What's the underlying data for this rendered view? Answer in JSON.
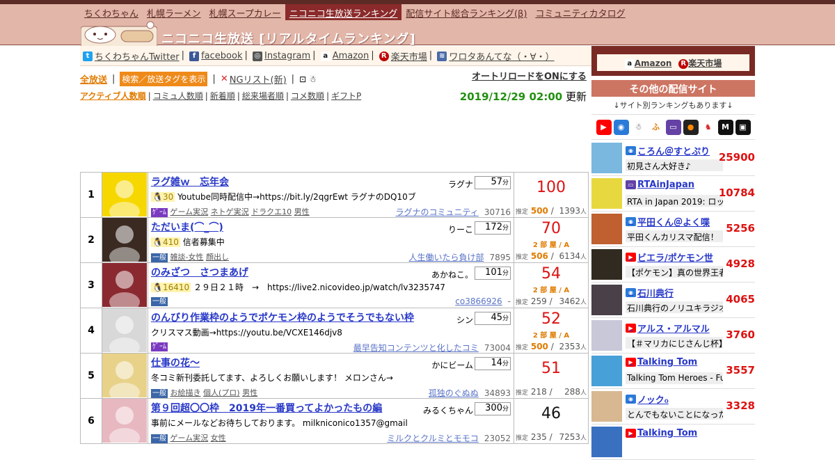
{
  "nav": {
    "items": [
      "ちくわちゃん",
      "札幌ラーメン",
      "札幌スープカレー",
      "ニコニコ生放送ランキング",
      "配信サイト総合ランキング(β)",
      "コミュニティカタログ"
    ],
    "selected_index": 3
  },
  "site_title": "ニコニコ生放送 [リアルタイムランキング]",
  "sublinks": {
    "twitter": "ちくわちゃんTwitter",
    "facebook": "facebook",
    "instagram": "Instagram",
    "amazon": "Amazon",
    "rakuten": "楽天市場",
    "wotaku": "ワロタあんてな（・∀・）"
  },
  "controls": {
    "all": "全放送",
    "search_tag": "検索／放送タグを表示",
    "ng_list": "NGリスト(新)",
    "autoreload": "オートリロードをONにする",
    "sort": [
      "アクティブ人数順",
      "コミュ人数順",
      "新着順",
      "総来場者順",
      "コメ数順",
      "ギフトP"
    ],
    "datetime": "2019/12/29 02:00",
    "update": "更新"
  },
  "labels": {
    "min": "分",
    "est": "推定",
    "person": "人",
    "game": "ｹﾞｰﾑ",
    "ippan": "一般"
  },
  "rows": [
    {
      "rank": "1",
      "title": "ラグ雑ｗ　忘年会",
      "owner": "ラグナ",
      "duration": "57",
      "level": "30",
      "desc": "Youtube同時配信中→https://bit.ly/2qgrEwt ラグナのDQ10ブ",
      "cat": "game",
      "tags": [
        "ゲーム実況",
        "ネトゲ実況",
        "ドラクエ10",
        "男性"
      ],
      "comm": "ラグナのコミュニティ",
      "commnum": "30716",
      "score": "100",
      "room": "",
      "active": "500",
      "visitors": "1393",
      "thumbcolor": "#f6d800"
    },
    {
      "rank": "2",
      "title": "ただいま(⌒_⌒)",
      "owner": "りーこ",
      "duration": "172",
      "level": "410",
      "desc": "信者募集中",
      "cat": "ippan",
      "tags": [
        "雑談-女性",
        "顔出し"
      ],
      "comm": "人生働いたら負け部",
      "commnum": "7895",
      "score": "70",
      "room": "2 部 屋 / A",
      "active": "506",
      "visitors": "6134",
      "thumbcolor": "#3a2a22"
    },
    {
      "rank": "3",
      "title": "のみざつ　さつまあげ",
      "owner": "あかねこ。",
      "duration": "101",
      "level": "16410",
      "desc": "２９日２１時　→　https://live2.nicovideo.jp/watch/lv3235747",
      "cat": "ippan",
      "tags": [],
      "comm": "co3866926",
      "commnum": "-",
      "score": "54",
      "room": "2 部 屋 / A",
      "active": "259",
      "visitors": "3462",
      "thumbcolor": "#8a2a30"
    },
    {
      "rank": "4",
      "title": "のんびり作業枠のようでポケモン枠のようでそうでもない枠",
      "owner": "シン",
      "duration": "45",
      "level": "",
      "desc": "クリスマス動画→https://youtu.be/VCXE146djv8",
      "cat": "game",
      "tags": [],
      "comm": "最早告知コンテンツと化したコミ",
      "commnum": "73004",
      "score": "52",
      "room": "2 部 屋 / A",
      "active": "500",
      "visitors": "2353",
      "thumbcolor": "#d8d8d8"
    },
    {
      "rank": "5",
      "title": "仕事の花～",
      "owner": "かにビーム",
      "duration": "14",
      "level": "",
      "desc": "冬コミ新刊委託してます、よろしくお願いします！ メロンさん→",
      "cat": "ippan",
      "tags": [
        "お絵描き",
        "個人(プロ)",
        "男性"
      ],
      "comm": "孤独のぐぬぬ",
      "commnum": "34893",
      "score": "51",
      "room": "",
      "active": "218",
      "visitors": "288",
      "thumbcolor": "#e8d28a"
    },
    {
      "rank": "6",
      "title": "第９回超〇〇枠　2019年一番買ってよかったもの編",
      "owner": "みるくちゃん",
      "duration": "300",
      "level": "",
      "desc": "事前にメールなどお待ちしております。 milkniconico1357@gmail",
      "cat": "ippan",
      "tags": [
        "ゲーム実況",
        "女性"
      ],
      "comm": "ミルクとクルミとモモコ",
      "commnum": "23052",
      "score": "46",
      "room": "",
      "active": "235",
      "visitors": "7253",
      "thumbcolor": "#e8b8c0"
    }
  ],
  "side": {
    "amazon": "Amazon",
    "rakuten": "楽天市場",
    "other_title": "その他の配信サイト",
    "other_sub": "↓サイト別ランキングもあります↓",
    "services": [
      "youtube-icon",
      "nicocas-icon",
      "nicolive-icon",
      "furatto-icon",
      "twitch-icon",
      "openrec-icon",
      "unicorn-icon",
      "mixer-icon",
      "tv-icon"
    ],
    "ranks": [
      {
        "name": "ころん＠すとぷり",
        "desc": "初見さん大好き♪",
        "value": "25900",
        "platform": "mirrativ",
        "avcolor": "#7ab8e0"
      },
      {
        "name": "RTAinJapan",
        "desc": "RTA in Japan 2019: ロッ",
        "value": "10784",
        "platform": "twitch",
        "avcolor": "#e8d840"
      },
      {
        "name": "平田くん＠よく喋",
        "desc": "平田くんカリスマ配信！",
        "value": "5256",
        "platform": "mirrativ",
        "avcolor": "#c06030"
      },
      {
        "name": "ビエラ/ポケモン世",
        "desc": "【ポケモン】真の世界王者",
        "value": "4928",
        "platform": "youtube",
        "avcolor": "#302a20"
      },
      {
        "name": "石川典行",
        "desc": "石川典行のノリユキラジオ",
        "value": "4065",
        "platform": "mirrativ",
        "avcolor": "#4a4048"
      },
      {
        "name": "アルス・アルマル",
        "desc": "【＃マリカにじさんじ杯】",
        "value": "3760",
        "platform": "youtube",
        "avcolor": "#c8c8d8"
      },
      {
        "name": "Talking Tom",
        "desc": "Talking Tom Heroes - Fun",
        "value": "3557",
        "platform": "youtube",
        "avcolor": "#48a0d8"
      },
      {
        "name": "ノックℴ",
        "desc": "とんでもないことになった",
        "value": "3328",
        "platform": "mirrativ",
        "avcolor": "#d8b890"
      },
      {
        "name": "Talking Tom",
        "desc": "",
        "value": "",
        "platform": "youtube",
        "avcolor": "#3a70c0"
      }
    ]
  },
  "colors": {
    "accent": "#8a2a2a",
    "header": "#e2b6a8",
    "score_red": "#dd1111",
    "date_green": "#229010",
    "orange": "#ee8a1a"
  }
}
